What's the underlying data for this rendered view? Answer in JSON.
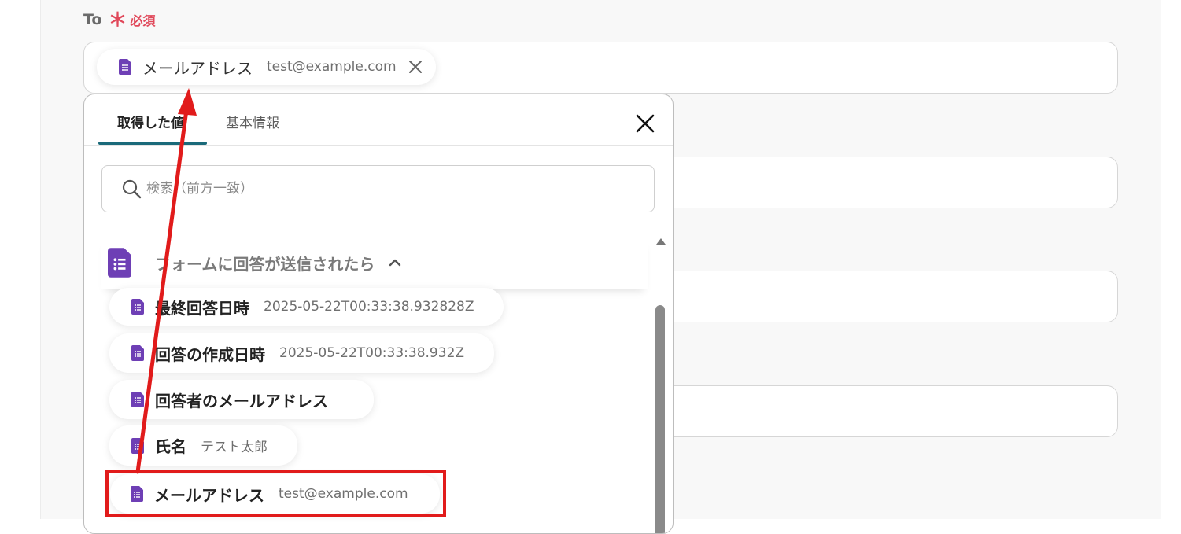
{
  "to_field": {
    "label": "To",
    "required_mark": "＊",
    "required_text": "必須",
    "chip": {
      "name": "メールアドレス",
      "value": "test@example.com"
    }
  },
  "panel": {
    "tabs": [
      {
        "label": "取得した値",
        "active": true
      },
      {
        "label": "基本情報",
        "active": false
      }
    ],
    "search": {
      "placeholder": "検索（前方一致）",
      "value": ""
    },
    "group": {
      "title": "フォームに回答が送信されたら",
      "expanded": true
    },
    "items": [
      {
        "name": "最終回答日時",
        "value": "2025-05-22T00:33:38.932828Z"
      },
      {
        "name": "回答の作成日時",
        "value": "2025-05-22T00:33:38.932Z"
      },
      {
        "name": "回答者のメールアドレス",
        "value": ""
      },
      {
        "name": "氏名",
        "value": "テスト太郎"
      },
      {
        "name": "メールアドレス",
        "value": "test@example.com",
        "highlighted": true
      }
    ]
  },
  "colors": {
    "accent_tab": "#1a6a7a",
    "required": "#e0485a",
    "forms_icon": "#6e3fb5",
    "annotation_red": "#e11b1b"
  },
  "icons": {
    "field_icon": "google-forms-icon",
    "close": "close-icon",
    "search": "search-icon",
    "collapse": "chevron-up-icon"
  }
}
